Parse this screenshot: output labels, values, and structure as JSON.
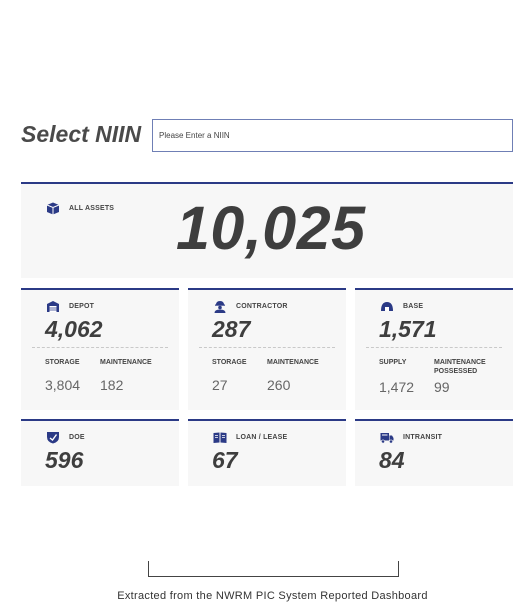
{
  "select": {
    "title": "Select NIIN",
    "placeholder": "Please Enter a NIIN",
    "value": ""
  },
  "all_assets": {
    "label": "ALL ASSETS",
    "value": "10,025",
    "icon": "cube-icon"
  },
  "cards": {
    "depot": {
      "label": "DEPOT",
      "value": "4,062",
      "icon": "warehouse-icon",
      "sub": [
        {
          "label": "STORAGE",
          "value": "3,804"
        },
        {
          "label": "MAINTENANCE",
          "value": "182"
        }
      ]
    },
    "contractor": {
      "label": "CONTRACTOR",
      "value": "287",
      "icon": "worker-icon",
      "sub": [
        {
          "label": "STORAGE",
          "value": "27"
        },
        {
          "label": "MAINTENANCE",
          "value": "260"
        }
      ]
    },
    "base": {
      "label": "BASE",
      "value": "1,571",
      "icon": "dome-icon",
      "sub": [
        {
          "label": "SUPPLY",
          "value": "1,472"
        },
        {
          "label": "MAINTENANCE POSSESSED",
          "value": "99"
        }
      ]
    },
    "doe": {
      "label": "DOE",
      "value": "596",
      "icon": "shield-icon"
    },
    "loan": {
      "label": "LOAN / LEASE",
      "value": "67",
      "icon": "book-icon"
    },
    "intransit": {
      "label": "INTRANSIT",
      "value": "84",
      "icon": "truck-icon"
    }
  },
  "caption": "Extracted from the NWRM PIC System Reported Dashboard",
  "colors": {
    "accent": "#2b3a86",
    "card_bg": "#f7f7f7",
    "text": "#3e3e3e"
  }
}
